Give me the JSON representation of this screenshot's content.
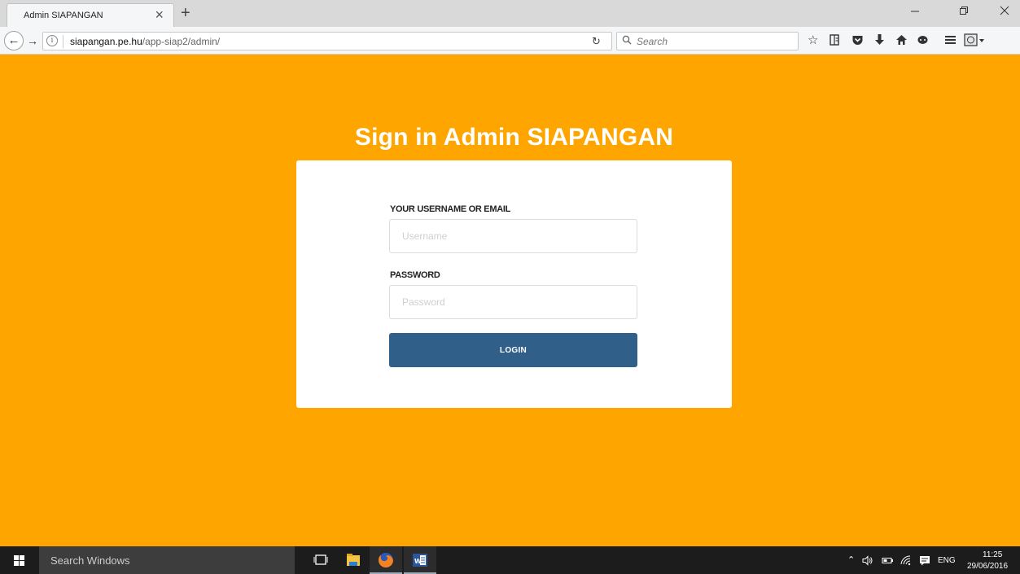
{
  "browser": {
    "tab_title": "Admin SIAPANGAN",
    "tab_close": "×",
    "new_tab": "+",
    "url_host": "siapangan.pe.hu",
    "url_path": "/app-siap2/admin/",
    "search_placeholder": "Search"
  },
  "page": {
    "title": "Sign in Admin SIAPANGAN",
    "username_label": "YOUR USERNAME OR EMAIL",
    "username_placeholder": "Username",
    "password_label": "PASSWORD",
    "password_placeholder": "Password",
    "login_label": "LOGIN"
  },
  "taskbar": {
    "search_text": "Search Windows",
    "language": "ENG",
    "time": "11:25",
    "date": "29/06/2016"
  },
  "colors": {
    "background": "#ffa500",
    "button": "#305f8a",
    "card": "#ffffff"
  }
}
